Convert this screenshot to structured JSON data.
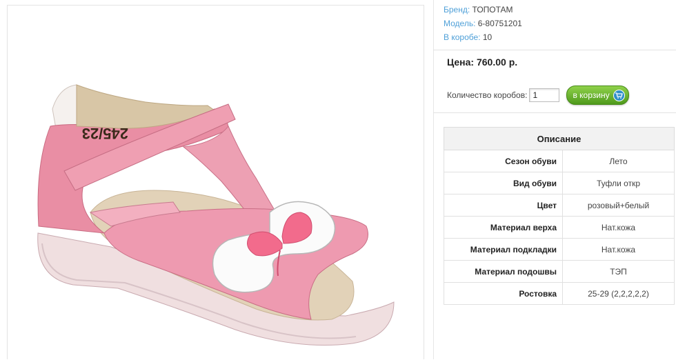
{
  "product": {
    "brand_label": "Бренд:",
    "brand_value": "ТОПОТАМ",
    "model_label": "Модель:",
    "model_value": "6-80751201",
    "box_label": "В коробе:",
    "box_value": "10",
    "image_alt": "Pink children's sandal with butterfly",
    "size_print": "245/23"
  },
  "purchase": {
    "price": "Цена: 760.00 р.",
    "qty_label": "Количество коробов:",
    "qty_value": "1",
    "cart_label": "в корзину"
  },
  "description": {
    "title": "Описание",
    "rows": [
      {
        "key": "Сезон обуви",
        "value": "Лето"
      },
      {
        "key": "Вид обуви",
        "value": "Туфли откр"
      },
      {
        "key": "Цвет",
        "value": "розовый+белый"
      },
      {
        "key": "Материал верха",
        "value": "Нат.кожа"
      },
      {
        "key": "Материал подкладки",
        "value": "Нат.кожа"
      },
      {
        "key": "Материал подошвы",
        "value": "ТЭП"
      },
      {
        "key": "Ростовка",
        "value": "25-29 (2,2,2,2,2)"
      }
    ]
  },
  "colors": {
    "label_blue": "#4fa0d8",
    "button_green": "#5aa824",
    "shoe_pink": "#e89aac"
  }
}
